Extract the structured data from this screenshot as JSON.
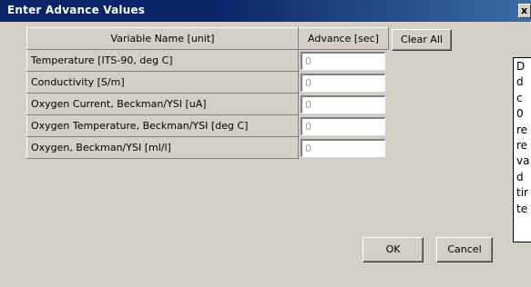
{
  "window": {
    "title": "Enter Advance Values",
    "close_glyph": "x"
  },
  "grid": {
    "headers": [
      "Variable Name [unit]",
      "Advance [sec]"
    ],
    "rows": [
      {
        "name": "Temperature [ITS-90, deg C]",
        "advance": "0"
      },
      {
        "name": "Conductivity [S/m]",
        "advance": "0"
      },
      {
        "name": "Oxygen Current, Beckman/YSI [uA]",
        "advance": "0"
      },
      {
        "name": "Oxygen Temperature, Beckman/YSI [deg C]",
        "advance": "0"
      },
      {
        "name": "Oxygen, Beckman/YSI [ml/l]",
        "advance": "0"
      }
    ]
  },
  "buttons": {
    "clear_all": "Clear All",
    "ok": "OK",
    "cancel": "Cancel"
  },
  "tooltip": {
    "lines": [
      "D",
      "d",
      "c",
      "0",
      "re",
      "re",
      "va",
      "d",
      "tir",
      "te"
    ]
  },
  "colors": {
    "title_bar": "#0a246a",
    "dialog_bg": "#d4d0c8"
  }
}
